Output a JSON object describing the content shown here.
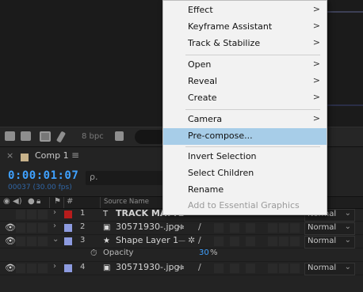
{
  "menu": {
    "groups": [
      [
        {
          "label": "Effect",
          "arrow": true
        },
        {
          "label": "Keyframe Assistant",
          "arrow": true
        },
        {
          "label": "Track & Stabilize",
          "arrow": true
        }
      ],
      [
        {
          "label": "Open",
          "arrow": true
        },
        {
          "label": "Reveal",
          "arrow": true
        },
        {
          "label": "Create",
          "arrow": true
        }
      ],
      [
        {
          "label": "Camera",
          "arrow": true
        },
        {
          "label": "Pre-compose...",
          "arrow": false,
          "highlight": true
        }
      ],
      [
        {
          "label": "Invert Selection",
          "arrow": false
        },
        {
          "label": "Select Children",
          "arrow": false
        },
        {
          "label": "Rename",
          "arrow": false
        },
        {
          "label": "Add to Essential Graphics",
          "arrow": false,
          "disabled": true
        }
      ]
    ],
    "arrow_glyph": ">"
  },
  "viewer": {
    "bpc_label": "8 bpc"
  },
  "comp": {
    "tab_close": "×",
    "name": "Comp 1",
    "menu_glyph": "≡",
    "swatch_color": "#c7b28a"
  },
  "time": {
    "timecode": "0:00:01:07",
    "frames": "00037 (30.00 fps)",
    "search_glyph": "ρ."
  },
  "columns": {
    "label_glyph": "⚑",
    "hash": "#",
    "source_name": "Source Name"
  },
  "layers": [
    {
      "num": "1",
      "label_color": "#b71c1c",
      "icon": "T",
      "name": "TRACK MATTE",
      "mode": "Normal",
      "has_eye": false,
      "type": "text"
    },
    {
      "num": "2",
      "label_color": "#8d9be0",
      "icon": "▣",
      "name": "30571930-.jpg",
      "mode": "Normal",
      "has_eye": true,
      "type": "footage"
    },
    {
      "num": "3",
      "label_color": "#8d9be0",
      "icon": "★",
      "name": "Shape Layer 1",
      "mode": "Normal",
      "has_eye": true,
      "type": "shape"
    },
    {
      "num": "4",
      "label_color": "#8d9be0",
      "icon": "▣",
      "name": "30571930-.jpg",
      "mode": "Normal",
      "has_eye": true,
      "type": "footage"
    }
  ],
  "opacity": {
    "label": "Opacity",
    "value": "30",
    "unit": "%"
  },
  "accent_color": "#3fa1ff"
}
